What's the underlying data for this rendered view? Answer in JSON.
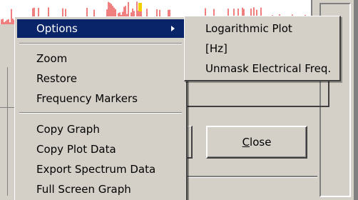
{
  "colors": {
    "window_face": "#d4d0c8",
    "menu_highlight": "#0a246a",
    "highlight_text": "#ffffff",
    "spectrum_trace": "#e00000",
    "marker_color": "#f0d000"
  },
  "context_menu": {
    "items": [
      {
        "label": "Options",
        "highlighted": true,
        "has_submenu": true
      },
      {
        "label": "Zoom"
      },
      {
        "label": "Restore"
      },
      {
        "label": "Frequency Markers"
      },
      {
        "label": "Copy Graph"
      },
      {
        "label": "Copy Plot Data"
      },
      {
        "label": "Export Spectrum Data"
      },
      {
        "label": "Full Screen Graph"
      }
    ]
  },
  "options_submenu": {
    "items": [
      {
        "label": "Logarithmic Plot"
      },
      {
        "label": "[Hz]"
      },
      {
        "label": "Unmask Electrical Freq."
      }
    ]
  },
  "close_button": {
    "mnemonic": "C",
    "rest": "lose"
  }
}
